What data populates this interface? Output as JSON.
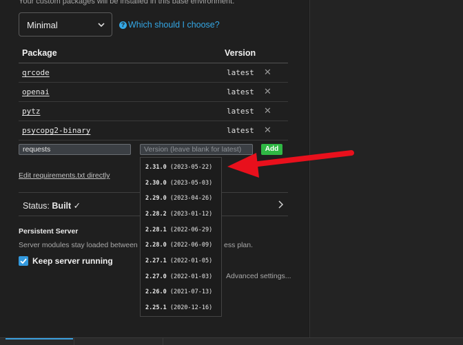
{
  "top_text": "Your custom packages will be installed in this base environment.",
  "environment": {
    "selected": "Minimal",
    "help_text": "Which should I choose?"
  },
  "table": {
    "headers": {
      "package": "Package",
      "version": "Version"
    },
    "rows": [
      {
        "name": "qrcode",
        "version": "latest"
      },
      {
        "name": "openai",
        "version": "latest"
      },
      {
        "name": "pytz",
        "version": "latest"
      },
      {
        "name": "psycopg2-binary",
        "version": "latest"
      }
    ],
    "delete_glyph": "✕"
  },
  "add_row": {
    "package_value": "requests",
    "version_placeholder": "Version (leave blank for latest)",
    "add_label": "Add"
  },
  "version_options": [
    {
      "version": "2.31.0",
      "date": "(2023-05-22)"
    },
    {
      "version": "2.30.0",
      "date": "(2023-05-03)"
    },
    {
      "version": "2.29.0",
      "date": "(2023-04-26)"
    },
    {
      "version": "2.28.2",
      "date": "(2023-01-12)"
    },
    {
      "version": "2.28.1",
      "date": "(2022-06-29)"
    },
    {
      "version": "2.28.0",
      "date": "(2022-06-09)"
    },
    {
      "version": "2.27.1",
      "date": "(2022-01-05)"
    },
    {
      "version": "2.27.0",
      "date": "(2022-01-03)"
    },
    {
      "version": "2.26.0",
      "date": "(2021-07-13)"
    },
    {
      "version": "2.25.1",
      "date": "(2020-12-16)"
    }
  ],
  "edit_requirements_label": "Edit requirements.txt directly",
  "status": {
    "label": "Status:",
    "value": "Built",
    "check": "✓"
  },
  "persistent_server": {
    "title": "Persistent Server",
    "description_start": "Server modules stay loaded between c",
    "description_end": "ess plan.",
    "keep_running_label": "Keep server running",
    "keep_running_checked": true,
    "advanced_label": "Advanced settings..."
  },
  "colors": {
    "accent": "#34a8e6",
    "add_button": "#2fb844",
    "arrow": "#e8101c",
    "checkbox": "#3399dd"
  }
}
